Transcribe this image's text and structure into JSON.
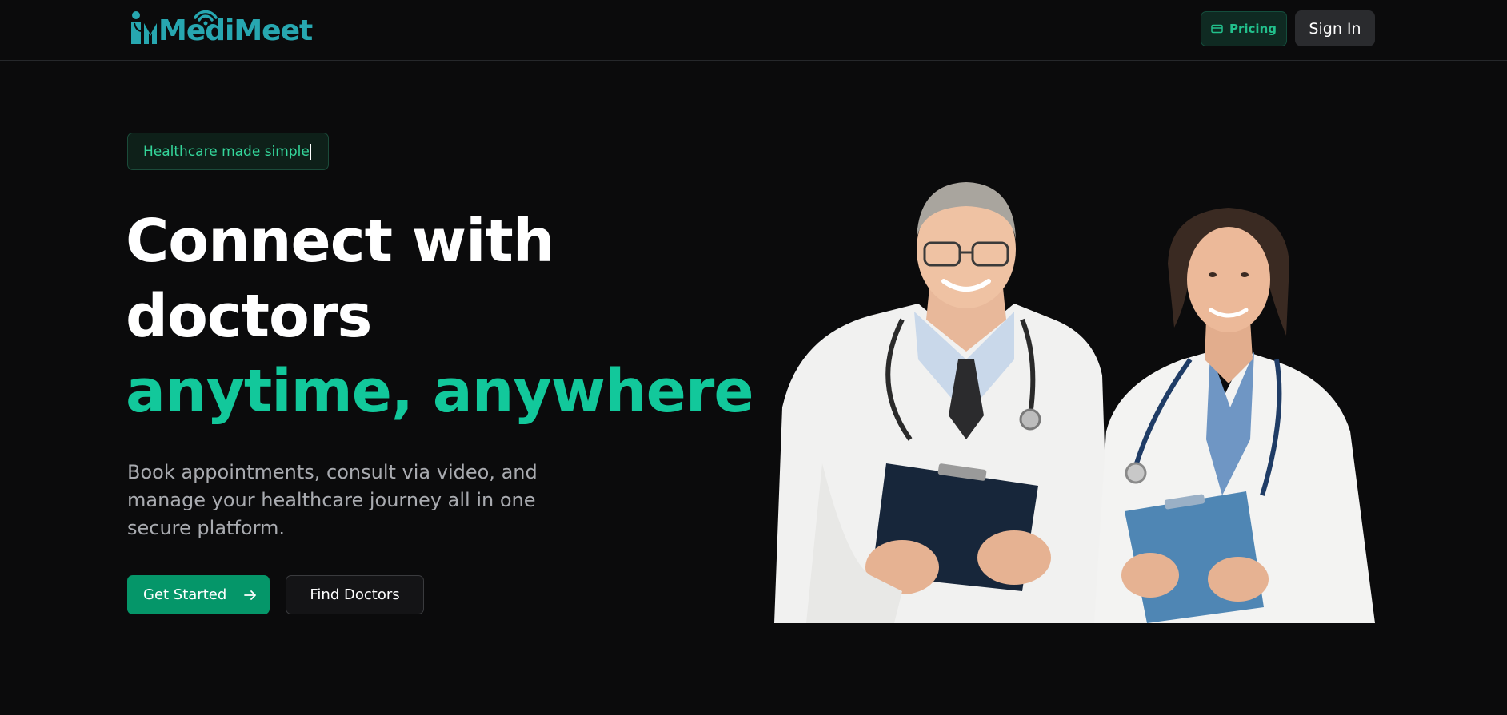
{
  "header": {
    "logo_text": "MediMeet",
    "pricing_label": "Pricing",
    "pricing_icon": "credit-card-icon",
    "signin_label": "Sign In"
  },
  "hero": {
    "badge": "Healthcare made simple",
    "headline_line1": "Connect with",
    "headline_line2": "doctors",
    "headline_accent": "anytime, anywhere",
    "description": "Book appointments, consult via video, and manage your healthcare journey all in one secure platform.",
    "primary_cta": "Get Started",
    "primary_cta_icon": "arrow-right-icon",
    "secondary_cta": "Find Doctors"
  },
  "colors": {
    "background": "#0b0b0c",
    "brand_teal": "#27a7b0",
    "accent_green": "#12c89b",
    "button_green": "#059669"
  }
}
